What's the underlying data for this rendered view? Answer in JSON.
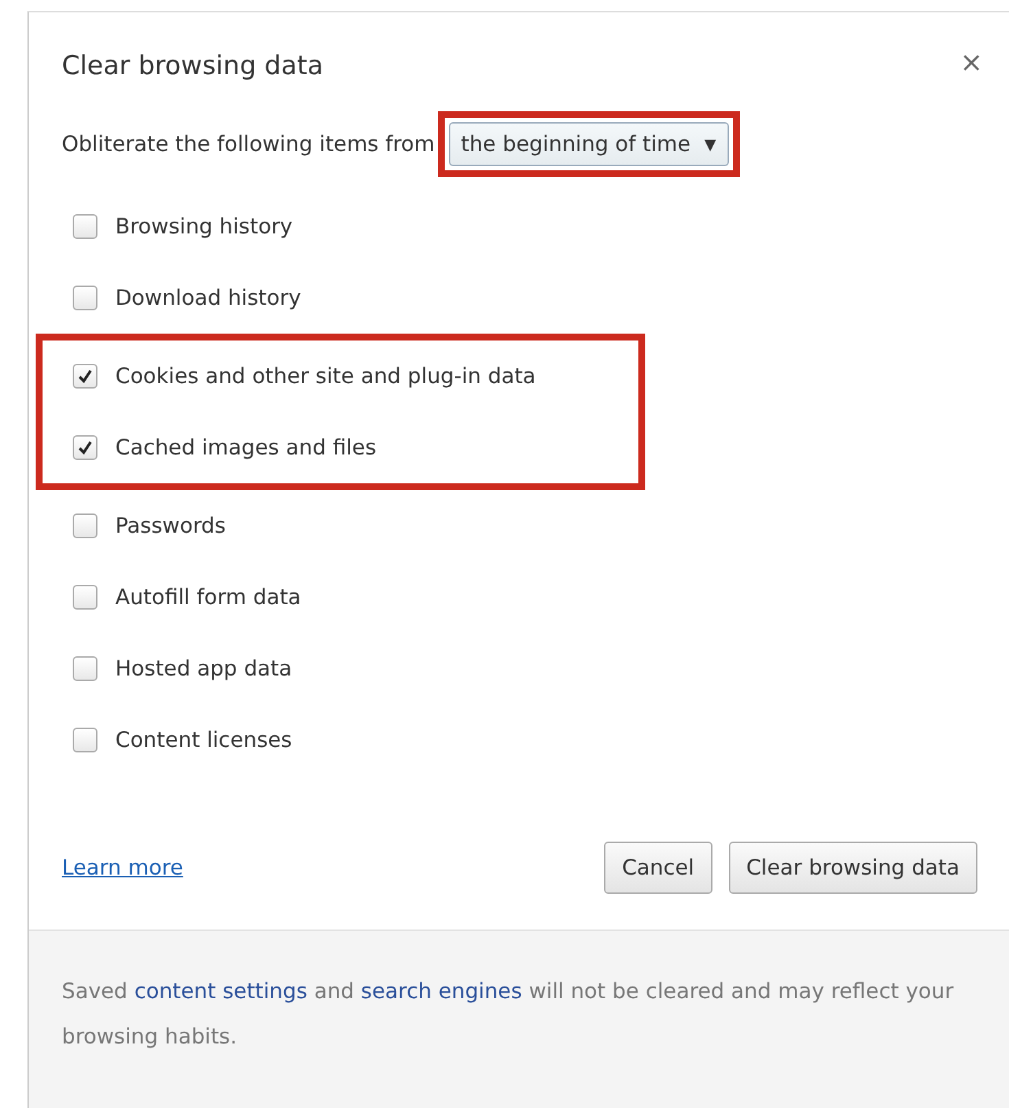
{
  "dialog": {
    "title": "Clear browsing data",
    "close": "×"
  },
  "range": {
    "label": "Obliterate the following items from",
    "value": "the beginning of time",
    "caret": "▼",
    "highlighted": true
  },
  "items": [
    {
      "label": "Browsing history",
      "checked": false,
      "highlighted": false
    },
    {
      "label": "Download history",
      "checked": false,
      "highlighted": false
    },
    {
      "label": "Cookies and other site and plug-in data",
      "checked": true,
      "highlighted": true
    },
    {
      "label": "Cached images and files",
      "checked": true,
      "highlighted": true
    },
    {
      "label": "Passwords",
      "checked": false,
      "highlighted": false
    },
    {
      "label": "Autofill form data",
      "checked": false,
      "highlighted": false
    },
    {
      "label": "Hosted app data",
      "checked": false,
      "highlighted": false
    },
    {
      "label": "Content licenses",
      "checked": false,
      "highlighted": false
    }
  ],
  "learn_more": "Learn more",
  "buttons": [
    "Cancel",
    "Clear browsing data"
  ],
  "footer": [
    {
      "kind": "text",
      "text": "Saved "
    },
    {
      "kind": "link",
      "text": "content settings"
    },
    {
      "kind": "text",
      "text": " and "
    },
    {
      "kind": "link",
      "text": "search engines"
    },
    {
      "kind": "text",
      "text": " will not be cleared and may reflect your browsing habits."
    }
  ]
}
